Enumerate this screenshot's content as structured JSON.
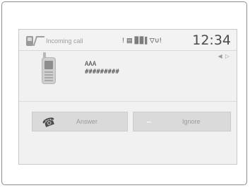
{
  "status_bar": {
    "title": "Incoming call",
    "indicators": "! ▤ ▊▊▌▽∪!",
    "clock": "12:34"
  },
  "corner_glyph": "◀ ▷",
  "caller": {
    "name": "AAA",
    "number": "#########"
  },
  "buttons": {
    "answer_label": "Answer",
    "ignore_label": "Ignore",
    "answer_icon_glyph": "☎",
    "ignore_icon_glyph": "⌢"
  }
}
